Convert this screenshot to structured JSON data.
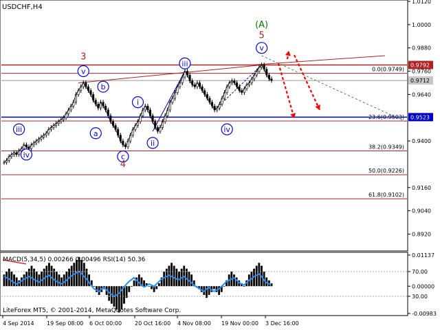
{
  "window": {
    "symbol_label": "USDCHF,H4"
  },
  "footer": {
    "copyright": "LiteForex MT5, © 2001-2014, MetaQuotes Software Corp."
  },
  "indicator": {
    "header": "MACD(5,34,5) 0.00266 0.00496 RSI(14) 50.36"
  },
  "colors": {
    "up_candle": "#000000",
    "down_candle": "#000000",
    "fib_line": "#b22222",
    "support_line": "#0000c8",
    "wave_circle": "#0000ff",
    "forecast_arrow": "#ff0000",
    "green_label": "#008000",
    "macd_hist": "#000000",
    "rsi_line": "#1e90ff",
    "signal_line": "#ff0000"
  },
  "chart_data": [
    {
      "type": "line",
      "title": "USDCHF,H4",
      "price_axis_ticks": [
        "1.0120",
        "1.0000",
        "0.9880",
        "0.9760",
        "0.9640",
        "0.9400",
        "0.9160",
        "0.9040",
        "0.8920"
      ],
      "ylim": [
        0.884,
        1.012
      ],
      "time_axis_ticks": [
        "4 Sep 2014",
        "19 Sep 08:00",
        "6 Oct 00:00",
        "20 Oct 16:00",
        "4 Nov 08:00",
        "19 Nov 00:00",
        "3 Dec 16:00"
      ],
      "price_markers": [
        {
          "label": "0.9792",
          "value": 0.9792,
          "style": "red"
        },
        {
          "label": "0.9712",
          "value": 0.9712,
          "style": "grey"
        },
        {
          "label": "0.9523",
          "value": 0.9523,
          "style": "blue"
        }
      ],
      "fib_levels": [
        {
          "label": "0.0(0.9749)",
          "value": 0.9749
        },
        {
          "label": "23.6(0.9503)",
          "value": 0.9503
        },
        {
          "label": "38.2(0.9349)",
          "value": 0.9349
        },
        {
          "label": "50.0(0.9226)",
          "value": 0.9226
        },
        {
          "label": "61.8(0.9102)",
          "value": 0.9102
        }
      ],
      "price_series": [
        0.929,
        0.93,
        0.932,
        0.933,
        0.934,
        0.933,
        0.935,
        0.936,
        0.938,
        0.937,
        0.936,
        0.938,
        0.939,
        0.94,
        0.941,
        0.942,
        0.943,
        0.944,
        0.946,
        0.947,
        0.948,
        0.949,
        0.95,
        0.951,
        0.952,
        0.954,
        0.956,
        0.958,
        0.96,
        0.964,
        0.966,
        0.968,
        0.97,
        0.968,
        0.966,
        0.964,
        0.961,
        0.959,
        0.957,
        0.96,
        0.958,
        0.956,
        0.953,
        0.95,
        0.948,
        0.946,
        0.943,
        0.94,
        0.938,
        0.937,
        0.94,
        0.943,
        0.946,
        0.948,
        0.95,
        0.953,
        0.956,
        0.958,
        0.956,
        0.953,
        0.95,
        0.947,
        0.945,
        0.947,
        0.95,
        0.953,
        0.956,
        0.96,
        0.962,
        0.965,
        0.968,
        0.97,
        0.973,
        0.976,
        0.974,
        0.971,
        0.969,
        0.968,
        0.97,
        0.968,
        0.966,
        0.964,
        0.962,
        0.96,
        0.958,
        0.956,
        0.957,
        0.959,
        0.962,
        0.965,
        0.968,
        0.97,
        0.971,
        0.97,
        0.968,
        0.966,
        0.965,
        0.967,
        0.969,
        0.97,
        0.972,
        0.974,
        0.976,
        0.978,
        0.9792,
        0.977,
        0.974,
        0.972,
        0.9712
      ],
      "wave_labels": [
        {
          "text": "iii",
          "shape": "circle",
          "at_index": 6,
          "price": 0.946
        },
        {
          "text": "iv",
          "shape": "circle",
          "at_index": 9,
          "price": 0.933
        },
        {
          "text": "v",
          "shape": "circle",
          "at_index": 32,
          "price": 0.976
        },
        {
          "text": "a",
          "shape": "circle",
          "at_index": 37,
          "price": 0.944
        },
        {
          "text": "b",
          "shape": "circle",
          "at_index": 40,
          "price": 0.968
        },
        {
          "text": "c",
          "shape": "circle",
          "at_index": 48,
          "price": 0.932
        },
        {
          "text": "i",
          "shape": "circle",
          "at_index": 54,
          "price": 0.96
        },
        {
          "text": "ii",
          "shape": "circle",
          "at_index": 60,
          "price": 0.939
        },
        {
          "text": "iii",
          "shape": "circle",
          "at_index": 73,
          "price": 0.98
        },
        {
          "text": "iv",
          "shape": "circle",
          "at_index": 90,
          "price": 0.946
        },
        {
          "text": "v",
          "shape": "circle",
          "at_index": 104,
          "price": 0.988
        }
      ],
      "major_labels": [
        {
          "text": "3",
          "at_index": 32,
          "price": 0.982,
          "color": "#b22222"
        },
        {
          "text": "4",
          "at_index": 48,
          "price": 0.9265,
          "color": "#b22222"
        },
        {
          "text": "5",
          "at_index": 104,
          "price": 0.993,
          "color": "#b22222"
        },
        {
          "text": "(A)",
          "at_index": 104,
          "price": 0.9985,
          "color": "#008000"
        }
      ]
    },
    {
      "type": "bar",
      "title": "MACD(5,34,5) 0.00266 0.00496 RSI(14) 50.36",
      "ticks": [
        "0.01137",
        "70.00",
        "0.00000",
        "30.00",
        "-0.00983"
      ],
      "macd_histogram": [
        0.004,
        0.005,
        0.006,
        0.005,
        0.004,
        0.003,
        0.002,
        0.003,
        0.004,
        0.005,
        0.006,
        0.007,
        0.006,
        0.005,
        0.004,
        0.005,
        0.006,
        0.007,
        0.008,
        0.007,
        0.006,
        0.005,
        0.004,
        0.003,
        0.004,
        0.005,
        0.006,
        0.007,
        0.008,
        0.009,
        0.01,
        0.009,
        0.008,
        0.006,
        0.004,
        0.002,
        0.0,
        -0.002,
        -0.003,
        -0.002,
        -0.001,
        -0.003,
        -0.005,
        -0.006,
        -0.007,
        -0.008,
        -0.009,
        -0.008,
        -0.006,
        -0.004,
        -0.002,
        0.0,
        0.002,
        0.003,
        0.004,
        0.003,
        0.002,
        0.001,
        0.0,
        -0.001,
        -0.002,
        -0.001,
        0.001,
        0.003,
        0.005,
        0.006,
        0.007,
        0.008,
        0.007,
        0.006,
        0.005,
        0.006,
        0.007,
        0.006,
        0.005,
        0.004,
        0.002,
        0.0,
        -0.001,
        -0.002,
        -0.003,
        -0.004,
        -0.003,
        -0.002,
        -0.001,
        -0.002,
        -0.003,
        -0.002,
        0.0,
        0.002,
        0.004,
        0.005,
        0.004,
        0.003,
        0.002,
        0.001,
        0.0,
        0.002,
        0.004,
        0.005,
        0.006,
        0.007,
        0.008,
        0.007,
        0.005,
        0.003,
        0.002,
        0.001
      ],
      "rsi": [
        62,
        60,
        58,
        55,
        52,
        50,
        52,
        55,
        58,
        60,
        62,
        60,
        57,
        55,
        53,
        56,
        59,
        62,
        64,
        60,
        57,
        54,
        52,
        50,
        53,
        56,
        60,
        63,
        66,
        68,
        70,
        67,
        62,
        58,
        52,
        47,
        42,
        40,
        38,
        42,
        44,
        40,
        36,
        33,
        30,
        32,
        35,
        40,
        45,
        50,
        54,
        57,
        60,
        56,
        52,
        48,
        45,
        47,
        50,
        48,
        46,
        50,
        54,
        58,
        60,
        62,
        64,
        62,
        60,
        58,
        57,
        60,
        62,
        58,
        55,
        52,
        48,
        45,
        43,
        40,
        38,
        42,
        44,
        40,
        38,
        40,
        42,
        46,
        50,
        54,
        56,
        58,
        60,
        56,
        52,
        50,
        48,
        52,
        56,
        58,
        62,
        64,
        66,
        62,
        56,
        52,
        50,
        50.36
      ]
    }
  ]
}
